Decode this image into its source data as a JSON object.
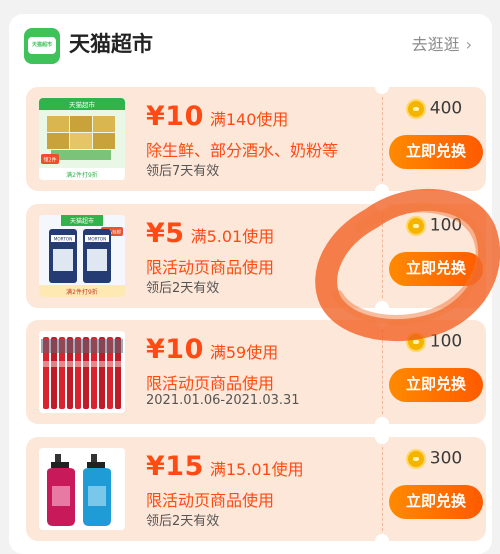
{
  "header": {
    "logo_text": "天猫超市",
    "title": "天猫超市",
    "link_label": "去逛逛",
    "link_chevron": "›"
  },
  "coupons": [
    {
      "price": "¥10",
      "threshold": "满140使用",
      "description": "除生鲜、部分酒水、奶粉等",
      "validity": "领后7天有效",
      "points": "400",
      "button_label": "立即兑换",
      "image": "grocery-product-image",
      "image_text": [
        "天猫超市",
        "领2件",
        "满2件打9折"
      ]
    },
    {
      "price": "¥5",
      "threshold": "满5.01使用",
      "description": "限活动页商品使用",
      "validity": "领后2天有效",
      "points": "100",
      "button_label": "立即兑换",
      "image": "sea-salt-product-image",
      "image_text": [
        "天猫超市",
        "单品包邮",
        "满2件打9折",
        "MORTON",
        "MORTON"
      ]
    },
    {
      "price": "¥10",
      "threshold": "满59使用",
      "description": "限活动页商品使用",
      "validity": "2021.01.06-2021.03.31",
      "points": "100",
      "button_label": "立即兑换",
      "image": "toothbrush-product-image"
    },
    {
      "price": "¥15",
      "threshold": "满15.01使用",
      "description": "限活动页商品使用",
      "validity": "领后2天有效",
      "points": "300",
      "button_label": "立即兑换",
      "image": "shampoo-product-image"
    }
  ],
  "colors": {
    "accent": "#ff4a13",
    "button_start": "#ff8a00",
    "button_end": "#ff5a00",
    "coupon_bg": "#fde7d9",
    "logo_green": "#3fc25a",
    "scribble": "#f05a1a"
  }
}
